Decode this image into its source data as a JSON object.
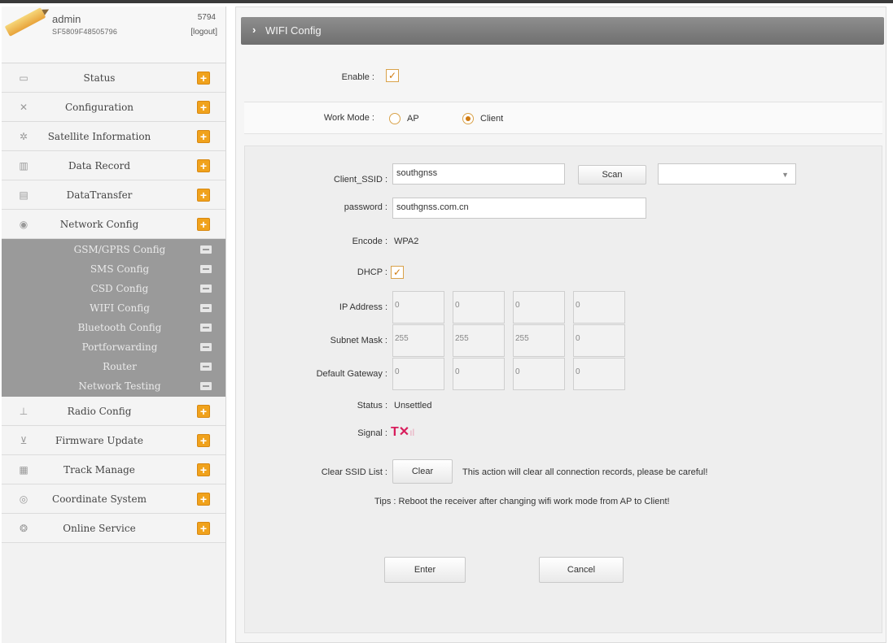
{
  "user": {
    "name": "admin",
    "serial": "SF5809F48505796",
    "id": "5794",
    "logout": "[logout]"
  },
  "menu": [
    {
      "label": "Status",
      "icon": "monitor-icon"
    },
    {
      "label": "Configuration",
      "icon": "tools-icon"
    },
    {
      "label": "Satellite Information",
      "icon": "satellite-icon"
    },
    {
      "label": "Data Record",
      "icon": "record-icon"
    },
    {
      "label": "DataTransfer",
      "icon": "transfer-icon"
    },
    {
      "label": "Network Config",
      "icon": "network-icon"
    }
  ],
  "submenu": [
    "GSM/GPRS Config",
    "SMS Config",
    "CSD Config",
    "WIFI Config",
    "Bluetooth Config",
    "Portforwarding",
    "Router",
    "Network Testing"
  ],
  "menu2": [
    {
      "label": "Radio Config",
      "icon": "radio-icon"
    },
    {
      "label": "Firmware Update",
      "icon": "firmware-icon"
    },
    {
      "label": "Track Manage",
      "icon": "calendar-icon"
    },
    {
      "label": "Coordinate System",
      "icon": "coordinate-icon"
    },
    {
      "label": "Online Service",
      "icon": "service-icon"
    }
  ],
  "panel": {
    "title": "WIFI Config",
    "enable_label": "Enable :",
    "workmode_label": "Work Mode :",
    "mode_ap": "AP",
    "mode_client": "Client",
    "ssid_label": "Client_SSID :",
    "ssid_value": "southgnss",
    "scan": "Scan",
    "password_label": "password :",
    "password_value": "southgnss.com.cn",
    "encode_label": "Encode :",
    "encode_value": "WPA2",
    "dhcp_label": "DHCP :",
    "ip_label": "IP Address :",
    "ip": [
      "0",
      "0",
      "0",
      "0"
    ],
    "mask_label": "Subnet Mask :",
    "mask": [
      "255",
      "255",
      "255",
      "0"
    ],
    "gateway_label": "Default Gateway :",
    "gateway": [
      "0",
      "0",
      "0",
      "0"
    ],
    "status_label": "Status :",
    "status_value": "Unsettled",
    "signal_label": "Signal :",
    "clear_label": "Clear SSID List :",
    "clear_btn": "Clear",
    "clear_note": "This action will clear all connection records, please be careful!",
    "tips": "Tips : Reboot the receiver after changing wifi work mode from AP to Client!",
    "enter": "Enter",
    "cancel": "Cancel"
  }
}
